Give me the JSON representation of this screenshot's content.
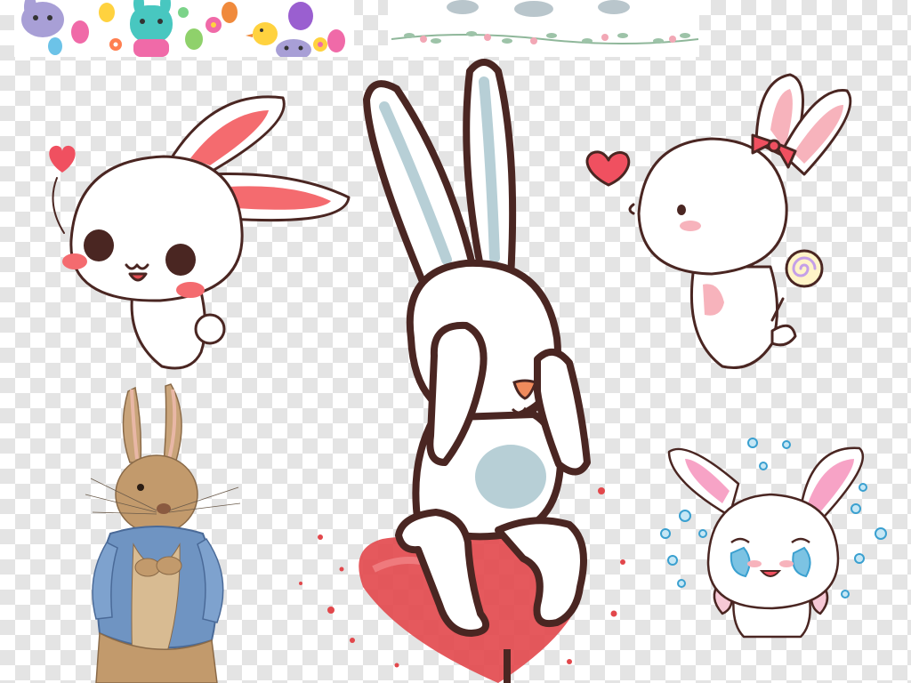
{
  "canvas": {
    "background": "transparency-checkerboard",
    "checker_color": "#e4e4e4"
  },
  "clipart": [
    {
      "name": "easter-pattern-strip",
      "icons": [
        "bunny-icon",
        "egg-icon",
        "chick-icon",
        "flower-icon"
      ]
    },
    {
      "name": "floral-garland-strip",
      "icons": [
        "flower-icon",
        "leaf-icon"
      ]
    },
    {
      "name": "cute-white-bunny-with-heart",
      "icons": [
        "bunny-icon",
        "heart-icon"
      ]
    },
    {
      "name": "tall-bunny-covering-eyes-on-heart",
      "icons": [
        "bunny-icon",
        "heart-icon"
      ]
    },
    {
      "name": "bunny-with-bow-and-lollipop",
      "icons": [
        "bunny-icon",
        "bow-icon",
        "lollipop-icon",
        "heart-icon"
      ]
    },
    {
      "name": "watercolor-rabbit-in-blue-jacket",
      "icons": [
        "rabbit-icon"
      ]
    },
    {
      "name": "crying-bunny-with-tears",
      "icons": [
        "bunny-icon",
        "teardrop-icon"
      ]
    }
  ],
  "colors": {
    "outline": "#4a2622",
    "bunny_white": "#ffffff",
    "ear_pink": "#f46b6f",
    "ear_light_pink": "#f7b3bc",
    "ear_blue": "#b7cfd6",
    "heart_red": "#f05060",
    "heart_watercolor": "#e2474b",
    "jacket_blue": "#6f94c2",
    "rabbit_tan": "#b98f60",
    "tear_blue": "#7cc3e3"
  }
}
